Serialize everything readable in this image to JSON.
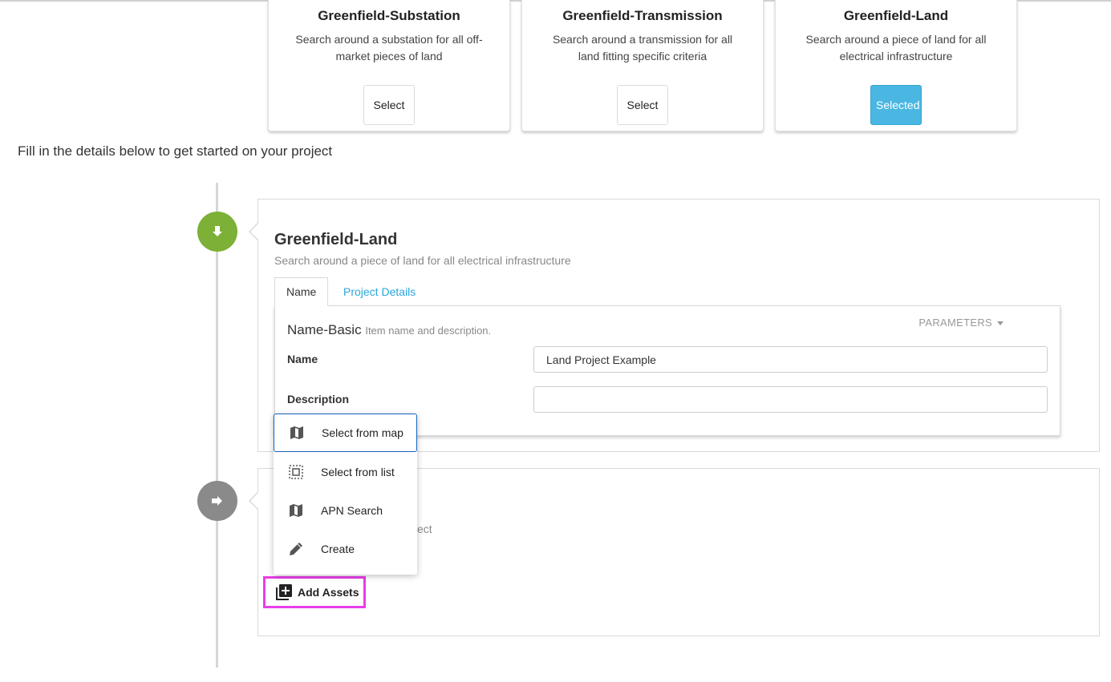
{
  "cards": [
    {
      "title": "Greenfield-Substation",
      "description": "Search around a substation for all off-market pieces of land",
      "button": "Select",
      "selected": false
    },
    {
      "title": "Greenfield-Transmission",
      "description": "Search around a transmission for all land fitting specific criteria",
      "button": "Select",
      "selected": false
    },
    {
      "title": "Greenfield-Land",
      "description": "Search around a piece of land for all electrical infrastructure",
      "button": "Selected",
      "selected": true
    }
  ],
  "intro_text": "Fill in the details below to get started on your project",
  "step1": {
    "icon": "arrow-down-icon",
    "color": "#7cb036",
    "title": "Greenfield-Land",
    "subtitle": "Search around a piece of land for all electrical infrastructure",
    "tabs": [
      {
        "label": "Name",
        "active": true
      },
      {
        "label": "Project Details",
        "active": false
      }
    ],
    "form": {
      "title": "Name-Basic",
      "title_hint": "Item name and description.",
      "parameters_label": "PARAMETERS",
      "name_label": "Name",
      "name_value": "Land Project Example",
      "description_label": "Description",
      "description_value": ""
    }
  },
  "step2": {
    "icon": "arrow-right-icon",
    "color": "#8a8a8a",
    "subtitle_fragment": "ect",
    "add_assets_label": "Add Assets"
  },
  "dropdown": {
    "items": [
      {
        "label": "Select from map",
        "icon": "map-icon",
        "focused": true
      },
      {
        "label": "Select from list",
        "icon": "select-list-icon",
        "focused": false
      },
      {
        "label": "APN Search",
        "icon": "map-icon",
        "focused": false
      },
      {
        "label": "Create",
        "icon": "pencil-icon",
        "focused": false
      }
    ]
  },
  "colors": {
    "accent": "#2aa6dc",
    "selected_button": "#4ab7e3",
    "highlight": "#e83ee8"
  }
}
